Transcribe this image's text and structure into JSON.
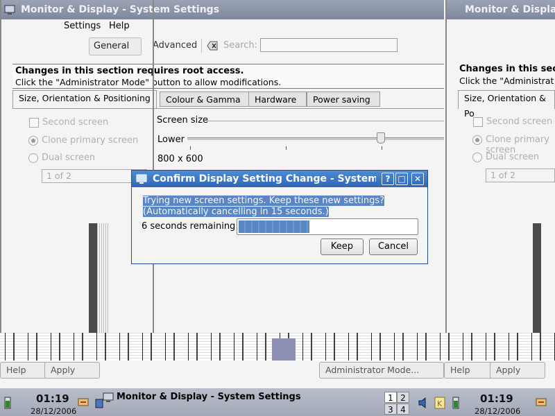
{
  "main_window": {
    "title": "Monitor & Display - System Settings",
    "menu": {
      "settings": "Settings",
      "help": "Help"
    },
    "toolbar": {
      "general": "General",
      "advanced": "Advanced",
      "search_label": "Search:",
      "search_value": ""
    },
    "root_notice": {
      "line1": "Changes in this section requires root access.",
      "line2": "Click the \"Administrator Mode\" button to allow modifications."
    },
    "tabs": [
      "Size, Orientation & Positioning",
      "Colour & Gamma",
      "Hardware",
      "Power saving"
    ],
    "options": {
      "second_screen": "Second screen",
      "clone_primary": "Clone primary screen",
      "dual_screen": "Dual screen",
      "screen_of": "1 of 2"
    },
    "screen_size": {
      "label": "Screen size",
      "lower": "Lower",
      "current": "800 x 600",
      "slider_level": 0.75
    },
    "buttons": {
      "help": "Help",
      "apply": "Apply",
      "admin_mode": "Administrator Mode..."
    }
  },
  "right_window": {
    "title": "Monitor & Display",
    "notice1": "Changes in this sec",
    "notice2": "Click the \"Administrat",
    "tab": "Size, Orientation & Po",
    "second_screen": "Second screen",
    "clone_primary": "Clone primary screen",
    "dual_screen": "Dual screen",
    "screen_of": "1 of 2"
  },
  "dialog": {
    "title": "Confirm Display Setting Change - System Settings",
    "message_line1": "Trying new screen settings. Keep these new settings?",
    "message_line2": "(Automatically cancelling in 15 seconds.)",
    "remaining": "6 seconds remaining:",
    "progress": 0.4,
    "keep": "Keep",
    "cancel": "Cancel",
    "title_buttons": {
      "help": "?",
      "maximize": "□",
      "close": "✕"
    }
  },
  "taskbar": {
    "time": "01:19",
    "date": "28/12/2006",
    "task": "Monitor & Display - System Settings",
    "desktops": [
      "1",
      "2",
      "3",
      "4"
    ]
  },
  "colors": {
    "titlebar_active": "#2d68b8",
    "titlebar_inactive": "#8a93a6",
    "selection": "#5a86c4"
  }
}
